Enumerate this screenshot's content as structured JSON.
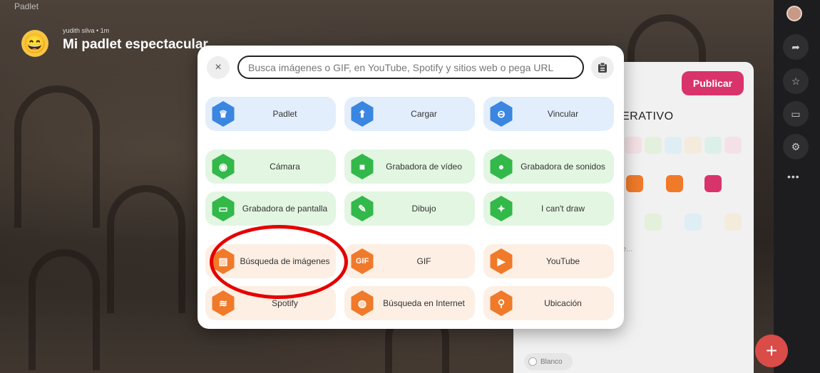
{
  "app": {
    "logo_text": "Padlet",
    "author_line": "yudith silva • 1m",
    "board_title": "Mi padlet espectacular"
  },
  "modal": {
    "search_placeholder": "Busca imágenes o GIF, en YouTube, Spotify y sitios web o pega URL",
    "close_glyph": "×",
    "tiles": [
      {
        "label": "Padlet",
        "color": "blue",
        "icon": "padlet-icon",
        "glyph": "♛"
      },
      {
        "label": "Cargar",
        "color": "blue",
        "icon": "upload-icon",
        "glyph": "⬆"
      },
      {
        "label": "Vincular",
        "color": "blue",
        "icon": "link-icon",
        "glyph": "⊖"
      },
      {
        "label": "Cámara",
        "color": "green",
        "icon": "camera-icon",
        "glyph": "◉"
      },
      {
        "label": "Grabadora de vídeo",
        "color": "green",
        "icon": "video-camera-icon",
        "glyph": "■"
      },
      {
        "label": "Grabadora de sonidos",
        "color": "green",
        "icon": "microphone-icon",
        "glyph": "●"
      },
      {
        "label": "Grabadora de pantalla",
        "color": "green",
        "icon": "screen-recorder-icon",
        "glyph": "▭"
      },
      {
        "label": "Dibujo",
        "color": "green",
        "icon": "brush-icon",
        "glyph": "✎"
      },
      {
        "label": "I can't draw",
        "color": "green",
        "icon": "sparkle-icon",
        "glyph": "✦"
      },
      {
        "label": "Búsqueda de imágenes",
        "color": "orange",
        "icon": "image-search-icon",
        "glyph": "▨"
      },
      {
        "label": "GIF",
        "color": "orange",
        "icon": "gif-icon",
        "glyph": "GIF"
      },
      {
        "label": "YouTube",
        "color": "orange",
        "icon": "youtube-icon",
        "glyph": "▶"
      },
      {
        "label": "Spotify",
        "color": "orange",
        "icon": "spotify-icon",
        "glyph": "≋"
      },
      {
        "label": "Búsqueda en Internet",
        "color": "orange",
        "icon": "globe-icon",
        "glyph": "◍"
      },
      {
        "label": "Ubicación",
        "color": "orange",
        "icon": "location-pin-icon",
        "glyph": "⚲"
      }
    ]
  },
  "side_panel": {
    "publish_label": "Publicar",
    "heading": "ERATIVO",
    "body_placeholder": "e...",
    "background_option": "Blanco"
  },
  "toolbar": {
    "more_glyph": "•••",
    "fab_glyph": "+"
  },
  "colors": {
    "publish": "#d9336b",
    "annotation": "#e50000",
    "fab": "#d94c48"
  }
}
